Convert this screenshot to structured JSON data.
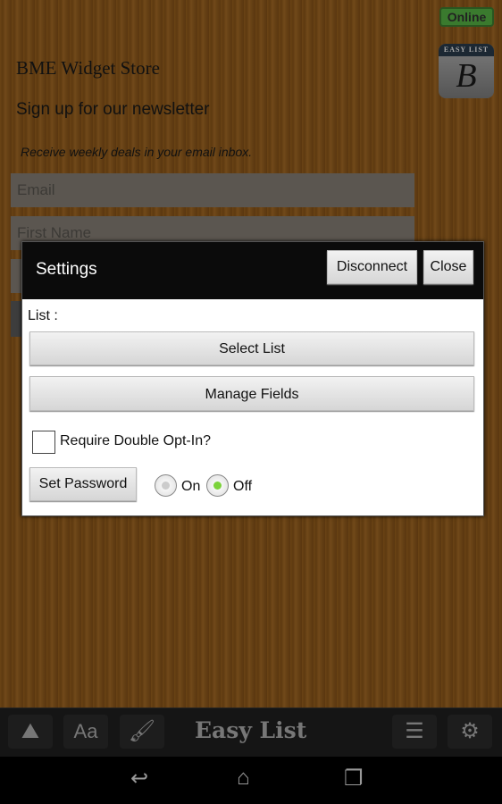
{
  "status": "Online",
  "logo": {
    "band": "EASY LIST",
    "letter": "B"
  },
  "page": {
    "store": "BME Widget Store",
    "heading": "Sign up for our newsletter",
    "subtext": "Receive weekly deals in your email inbox.",
    "fields": [
      {
        "placeholder": "Email"
      },
      {
        "placeholder": "First Name"
      },
      {
        "placeholder": ""
      }
    ]
  },
  "dialog": {
    "title": "Settings",
    "disconnect": "Disconnect",
    "close": "Close",
    "list_label": "List :",
    "select_list": "Select List",
    "manage_fields": "Manage Fields",
    "double_optin": "Require Double Opt-In?",
    "double_optin_checked": false,
    "set_password": "Set Password",
    "radio_on": "On",
    "radio_off": "Off",
    "password_selected": "Off"
  },
  "toolbar": {
    "title": "Easy List"
  }
}
